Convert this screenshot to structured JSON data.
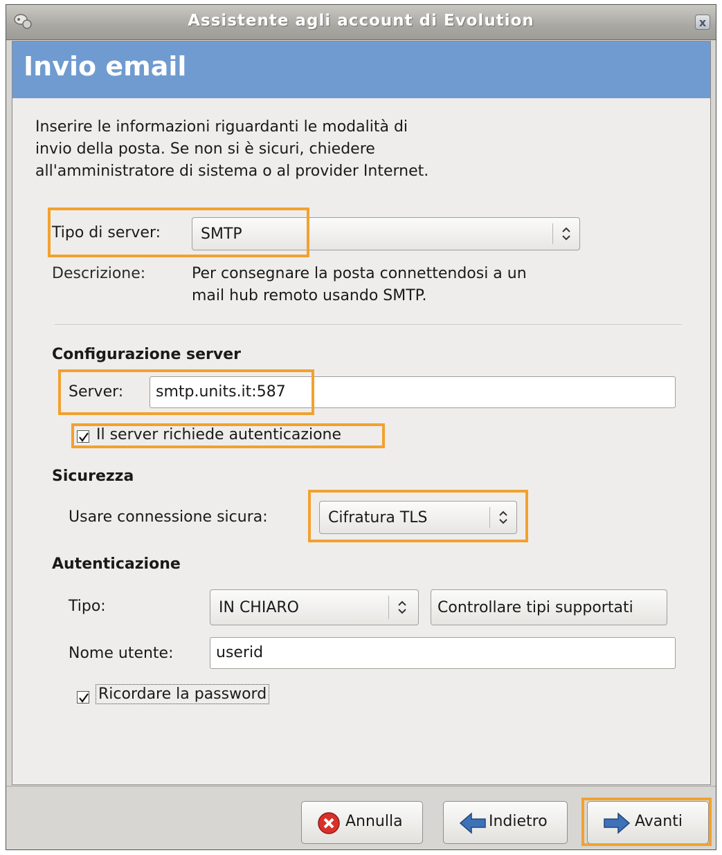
{
  "window": {
    "title": "Assistente agli account di Evolution",
    "close_label": "x"
  },
  "page": {
    "title": "Invio email",
    "intro_lines": [
      "Inserire le informazioni riguardanti le modalità di",
      "invio della posta. Se non si è sicuri, chiedere",
      "all'amministratore di sistema o al provider Internet."
    ]
  },
  "server_type": {
    "label": "Tipo di server:",
    "value": "SMTP",
    "description_label": "Descrizione:",
    "description_lines": [
      "Per consegnare la posta connettendosi a un",
      "mail hub remoto usando SMTP."
    ]
  },
  "server_config": {
    "heading": "Configurazione server",
    "server_label": "Server:",
    "server_value": "smtp.units.it:587",
    "auth_required_label": "Il server richiede autenticazione",
    "auth_required_checked": true
  },
  "security": {
    "heading": "Sicurezza",
    "secure_label": "Usare connessione sicura:",
    "secure_value": "Cifratura TLS"
  },
  "authentication": {
    "heading": "Autenticazione",
    "type_label": "Tipo:",
    "type_value": "IN CHIARO",
    "check_types_label": "Controllare tipi supportati",
    "username_label": "Nome utente:",
    "username_value": "userid",
    "remember_password_label": "Ricordare la  password",
    "remember_password_checked": true
  },
  "buttons": {
    "cancel": "Annulla",
    "back": "Indietro",
    "next": "Avanti"
  },
  "colors": {
    "header_band": "#6f9bd0",
    "highlight": "#f2a12e"
  },
  "icons": {
    "app": "evolution-app-icon",
    "close": "close-icon",
    "combo": "updown-arrows-icon",
    "cancel": "red-x-icon",
    "back": "blue-arrow-left-icon",
    "next": "blue-arrow-right-icon",
    "check": "checkmark-icon"
  }
}
